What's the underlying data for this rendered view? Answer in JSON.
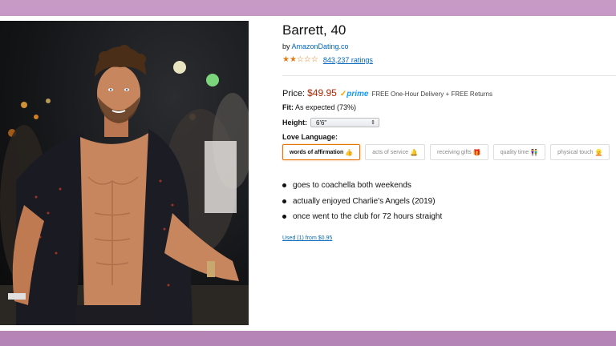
{
  "product": {
    "title": "Barrett, 40",
    "by_prefix": "by ",
    "seller": "AmazonDating.co",
    "rating_stars": "★★☆☆☆",
    "rating_count": "843,237 ratings",
    "price_label": "Price:",
    "price_value": "$49.95",
    "prime_check": "✓",
    "prime_label": "prime",
    "delivery": "FREE One-Hour Delivery + FREE Returns",
    "fit_label": "Fit:",
    "fit_value": "As expected (73%)",
    "height_label": "Height:",
    "height_value": "6'6\"",
    "love_language_label": "Love Language:",
    "love_options": [
      {
        "label": "words of affirmation",
        "emoji": "👍",
        "selected": true
      },
      {
        "label": "acts of service",
        "emoji": "🔔"
      },
      {
        "label": "receiving gifts",
        "emoji": "🎁"
      },
      {
        "label": "quality time",
        "emoji": "👫"
      },
      {
        "label": "physical touch",
        "emoji": "👱"
      }
    ],
    "bullets": [
      "goes to coachella both weekends",
      "actually enjoyed Charlie's Angels (2019)",
      "once went to the club for 72 hours straight"
    ],
    "used_link": "Used (1) from $0.95"
  },
  "colors": {
    "price": "#b12704",
    "link": "#0066c0",
    "prime": "#1399ff",
    "selected_border": "#e77600",
    "background_band": "#c79ac6"
  }
}
